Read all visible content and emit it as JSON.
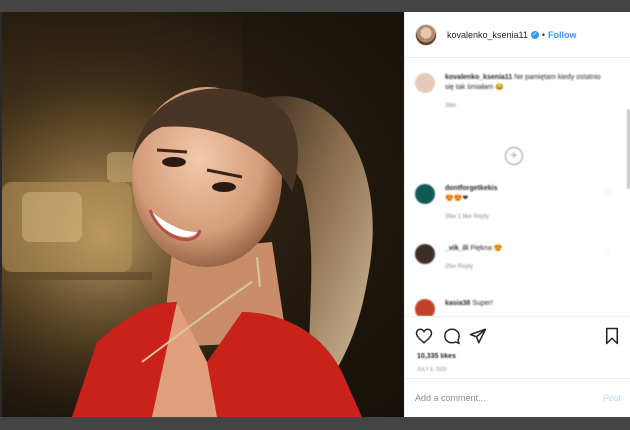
{
  "post": {
    "username": "kovalenko_ksenia11",
    "follow_separator": "•",
    "follow_label": "Follow",
    "verified_mark": "✓"
  },
  "comments": {
    "caption": {
      "username": "kovalenko_ksenia11",
      "text": "Ne pamiętam kiedy ostatnio się tak śmiałam 😂",
      "meta": "36w"
    },
    "items": [
      {
        "username": "dontforgetkekis",
        "text": "😍😍❤",
        "meta": "36w  1 like  Reply"
      },
      {
        "username": "_vik_ili",
        "text": "Piękna 😍",
        "meta": "35w  Reply"
      },
      {
        "username": "kasia38",
        "text": "Super!",
        "meta": ""
      }
    ]
  },
  "actions": {
    "likes": "10,335 likes",
    "date": "JULY 6, 2020"
  },
  "add_comment": {
    "placeholder": "Add a comment...",
    "post_label": "Post"
  },
  "icons": [
    "heart-icon",
    "comment-icon",
    "share-icon",
    "bookmark-icon",
    "add-icon",
    "verified-icon"
  ],
  "colors": {
    "accent": "#3897f0",
    "post_disabled": "#b2dffc",
    "dress": "#c8221a"
  }
}
